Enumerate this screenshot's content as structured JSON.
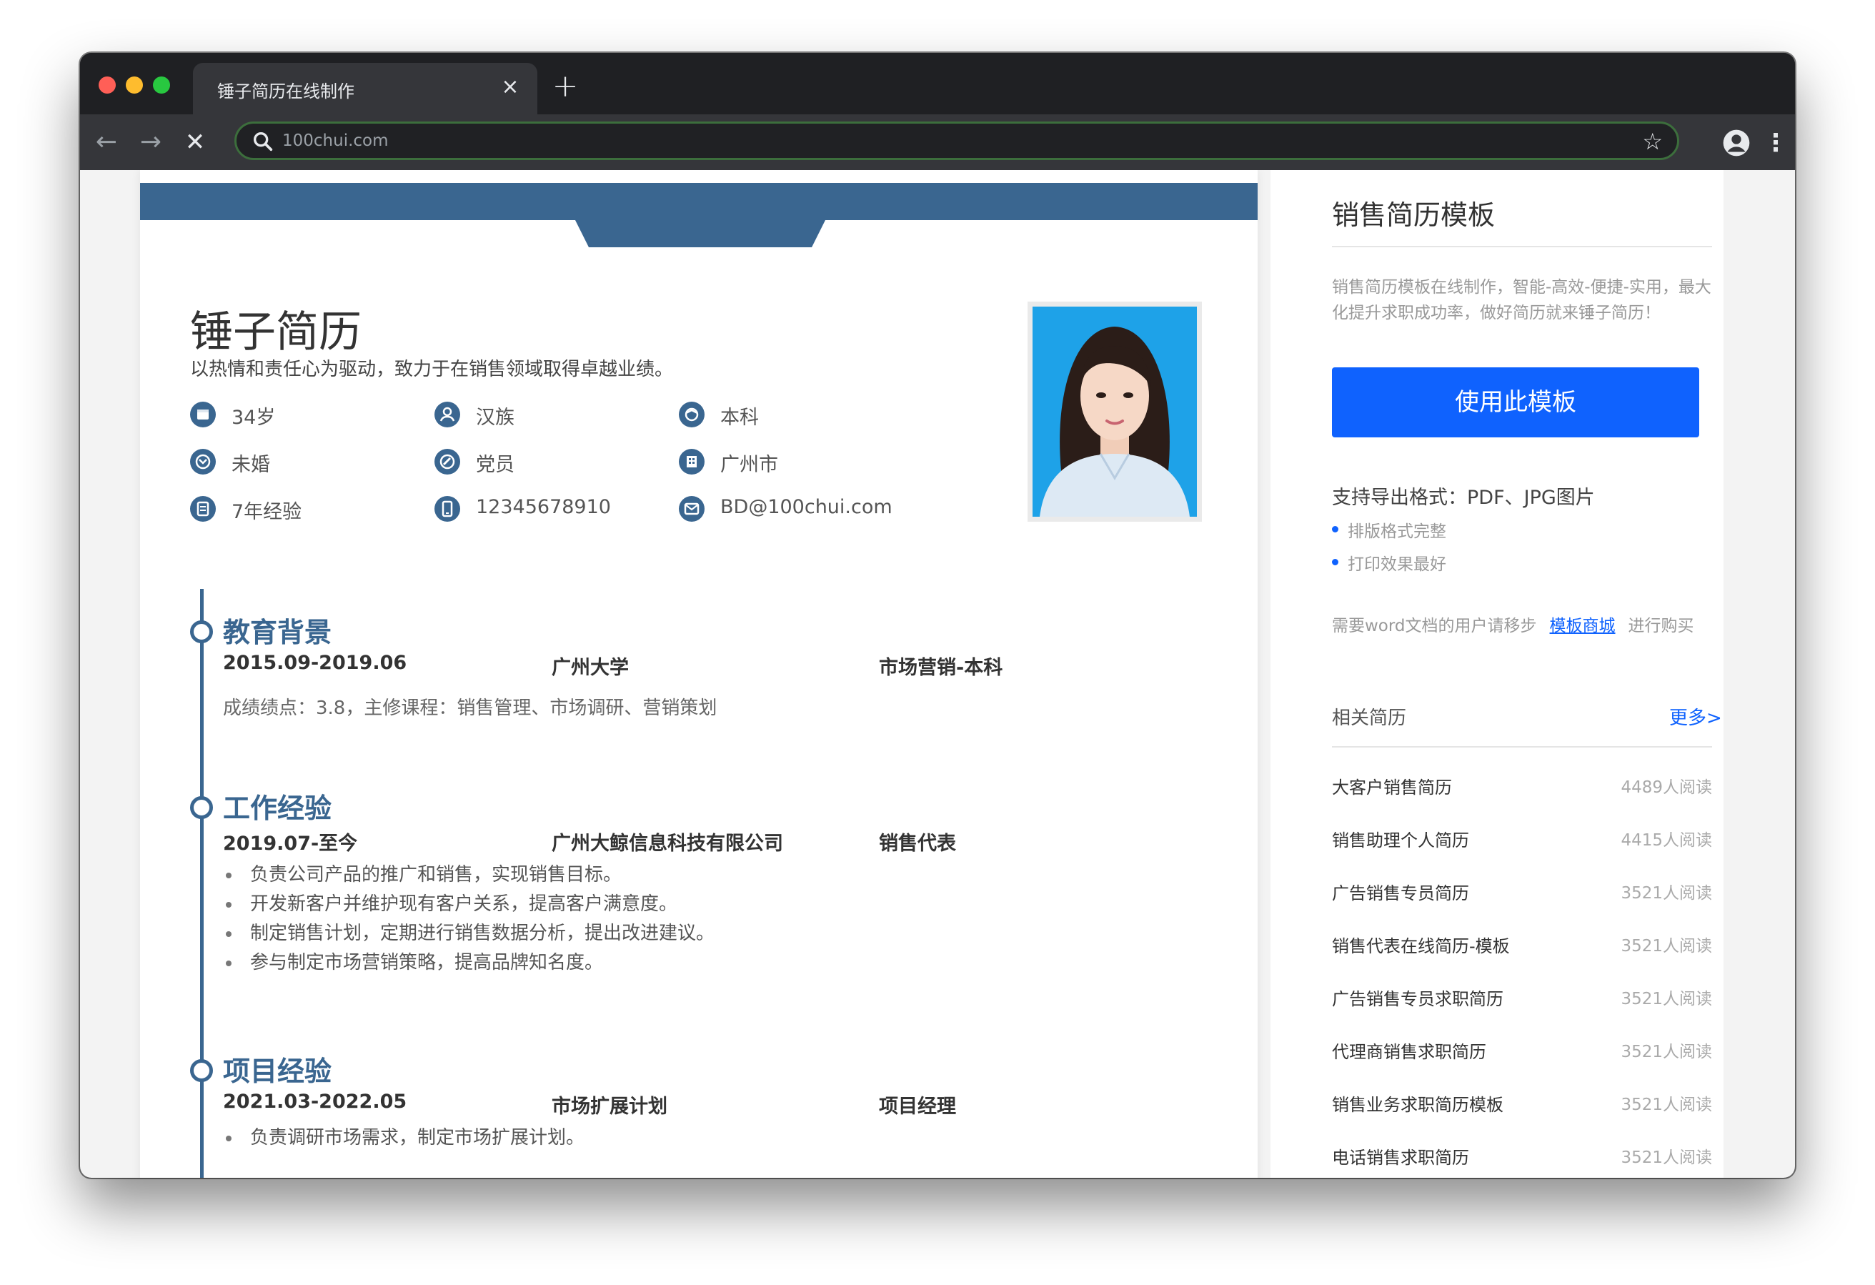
{
  "browser": {
    "tab_title": "锤子简历在线制作",
    "tab_close": "×",
    "new_tab": "+",
    "url": "100chui.com",
    "back": "←",
    "forward": "→",
    "stop": "✕",
    "star": "☆",
    "menu": "⋮",
    "colors": {
      "close": "#ff5f57",
      "minimize": "#febc2e",
      "maximize": "#28c840"
    }
  },
  "resume": {
    "name": "锤子简历",
    "tagline": "以热情和责任心为驱动，致力于在销售领域取得卓越业绩。",
    "info": [
      {
        "icon": "calendar-icon",
        "text": "34岁"
      },
      {
        "icon": "person-icon",
        "text": "汉族"
      },
      {
        "icon": "graduation-cap-icon",
        "text": "本科"
      },
      {
        "icon": "heart-icon",
        "text": "未婚"
      },
      {
        "icon": "party-badge-icon",
        "text": "党员"
      },
      {
        "icon": "building-icon",
        "text": "广州市"
      },
      {
        "icon": "document-icon",
        "text": "7年经验"
      },
      {
        "icon": "phone-icon",
        "text": "12345678910"
      },
      {
        "icon": "mail-icon",
        "text": "BD@100chui.com"
      }
    ],
    "education": {
      "title": "教育背景",
      "date": "2015.09-2019.06",
      "school": "广州大学",
      "major": "市场营销-本科",
      "detail": "成绩绩点：3.8，主修课程：销售管理、市场调研、营销策划"
    },
    "work": {
      "title": "工作经验",
      "date": "2019.07-至今",
      "company": "广州大鲸信息科技有限公司",
      "role": "销售代表",
      "bullets": [
        "负责公司产品的推广和销售，实现销售目标。",
        "开发新客户并维护现有客户关系，提高客户满意度。",
        "制定销售计划，定期进行销售数据分析，提出改进建议。",
        "参与制定市场营销策略，提高品牌知名度。"
      ]
    },
    "project": {
      "title": "项目经验",
      "date": "2021.03-2022.05",
      "name": "市场扩展计划",
      "role": "项目经理",
      "bullets": [
        "负责调研市场需求，制定市场扩展计划。"
      ]
    }
  },
  "sidebar": {
    "title": "销售简历模板",
    "description": "销售简历模板在线制作，智能-高效-便捷-实用，最大化提升求职成功率，做好简历就来锤子简历！",
    "use_button": "使用此模板",
    "formats": "支持导出格式：PDF、JPG图片",
    "features": [
      "排版格式完整",
      "打印效果最好"
    ],
    "note_before": "需要word文档的用户请移步",
    "note_link": "模板商城",
    "note_after": "进行购买",
    "related_title": "相关简历",
    "more": "更多>",
    "related": [
      {
        "name": "大客户销售简历",
        "count": "4489人阅读"
      },
      {
        "name": "销售助理个人简历",
        "count": "4415人阅读"
      },
      {
        "name": "广告销售专员简历",
        "count": "3521人阅读"
      },
      {
        "name": "销售代表在线简历-模板",
        "count": "3521人阅读"
      },
      {
        "name": "广告销售专员求职简历",
        "count": "3521人阅读"
      },
      {
        "name": "代理商销售求职简历",
        "count": "3521人阅读"
      },
      {
        "name": "销售业务求职简历模板",
        "count": "3521人阅读"
      },
      {
        "name": "电话销售求职简历",
        "count": "3521人阅读"
      }
    ]
  },
  "theme": {
    "resume_accent": "#3a6690",
    "button_blue": "#0f62fe"
  }
}
